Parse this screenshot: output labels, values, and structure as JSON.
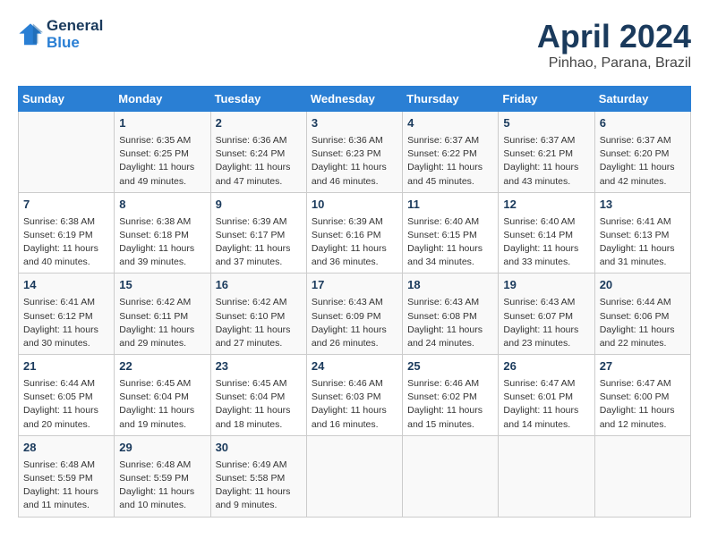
{
  "header": {
    "logo_line1": "General",
    "logo_line2": "Blue",
    "month": "April 2024",
    "location": "Pinhao, Parana, Brazil"
  },
  "days_of_week": [
    "Sunday",
    "Monday",
    "Tuesday",
    "Wednesday",
    "Thursday",
    "Friday",
    "Saturday"
  ],
  "weeks": [
    [
      {
        "day": "",
        "content": ""
      },
      {
        "day": "1",
        "content": "Sunrise: 6:35 AM\nSunset: 6:25 PM\nDaylight: 11 hours\nand 49 minutes."
      },
      {
        "day": "2",
        "content": "Sunrise: 6:36 AM\nSunset: 6:24 PM\nDaylight: 11 hours\nand 47 minutes."
      },
      {
        "day": "3",
        "content": "Sunrise: 6:36 AM\nSunset: 6:23 PM\nDaylight: 11 hours\nand 46 minutes."
      },
      {
        "day": "4",
        "content": "Sunrise: 6:37 AM\nSunset: 6:22 PM\nDaylight: 11 hours\nand 45 minutes."
      },
      {
        "day": "5",
        "content": "Sunrise: 6:37 AM\nSunset: 6:21 PM\nDaylight: 11 hours\nand 43 minutes."
      },
      {
        "day": "6",
        "content": "Sunrise: 6:37 AM\nSunset: 6:20 PM\nDaylight: 11 hours\nand 42 minutes."
      }
    ],
    [
      {
        "day": "7",
        "content": "Sunrise: 6:38 AM\nSunset: 6:19 PM\nDaylight: 11 hours\nand 40 minutes."
      },
      {
        "day": "8",
        "content": "Sunrise: 6:38 AM\nSunset: 6:18 PM\nDaylight: 11 hours\nand 39 minutes."
      },
      {
        "day": "9",
        "content": "Sunrise: 6:39 AM\nSunset: 6:17 PM\nDaylight: 11 hours\nand 37 minutes."
      },
      {
        "day": "10",
        "content": "Sunrise: 6:39 AM\nSunset: 6:16 PM\nDaylight: 11 hours\nand 36 minutes."
      },
      {
        "day": "11",
        "content": "Sunrise: 6:40 AM\nSunset: 6:15 PM\nDaylight: 11 hours\nand 34 minutes."
      },
      {
        "day": "12",
        "content": "Sunrise: 6:40 AM\nSunset: 6:14 PM\nDaylight: 11 hours\nand 33 minutes."
      },
      {
        "day": "13",
        "content": "Sunrise: 6:41 AM\nSunset: 6:13 PM\nDaylight: 11 hours\nand 31 minutes."
      }
    ],
    [
      {
        "day": "14",
        "content": "Sunrise: 6:41 AM\nSunset: 6:12 PM\nDaylight: 11 hours\nand 30 minutes."
      },
      {
        "day": "15",
        "content": "Sunrise: 6:42 AM\nSunset: 6:11 PM\nDaylight: 11 hours\nand 29 minutes."
      },
      {
        "day": "16",
        "content": "Sunrise: 6:42 AM\nSunset: 6:10 PM\nDaylight: 11 hours\nand 27 minutes."
      },
      {
        "day": "17",
        "content": "Sunrise: 6:43 AM\nSunset: 6:09 PM\nDaylight: 11 hours\nand 26 minutes."
      },
      {
        "day": "18",
        "content": "Sunrise: 6:43 AM\nSunset: 6:08 PM\nDaylight: 11 hours\nand 24 minutes."
      },
      {
        "day": "19",
        "content": "Sunrise: 6:43 AM\nSunset: 6:07 PM\nDaylight: 11 hours\nand 23 minutes."
      },
      {
        "day": "20",
        "content": "Sunrise: 6:44 AM\nSunset: 6:06 PM\nDaylight: 11 hours\nand 22 minutes."
      }
    ],
    [
      {
        "day": "21",
        "content": "Sunrise: 6:44 AM\nSunset: 6:05 PM\nDaylight: 11 hours\nand 20 minutes."
      },
      {
        "day": "22",
        "content": "Sunrise: 6:45 AM\nSunset: 6:04 PM\nDaylight: 11 hours\nand 19 minutes."
      },
      {
        "day": "23",
        "content": "Sunrise: 6:45 AM\nSunset: 6:04 PM\nDaylight: 11 hours\nand 18 minutes."
      },
      {
        "day": "24",
        "content": "Sunrise: 6:46 AM\nSunset: 6:03 PM\nDaylight: 11 hours\nand 16 minutes."
      },
      {
        "day": "25",
        "content": "Sunrise: 6:46 AM\nSunset: 6:02 PM\nDaylight: 11 hours\nand 15 minutes."
      },
      {
        "day": "26",
        "content": "Sunrise: 6:47 AM\nSunset: 6:01 PM\nDaylight: 11 hours\nand 14 minutes."
      },
      {
        "day": "27",
        "content": "Sunrise: 6:47 AM\nSunset: 6:00 PM\nDaylight: 11 hours\nand 12 minutes."
      }
    ],
    [
      {
        "day": "28",
        "content": "Sunrise: 6:48 AM\nSunset: 5:59 PM\nDaylight: 11 hours\nand 11 minutes."
      },
      {
        "day": "29",
        "content": "Sunrise: 6:48 AM\nSunset: 5:59 PM\nDaylight: 11 hours\nand 10 minutes."
      },
      {
        "day": "30",
        "content": "Sunrise: 6:49 AM\nSunset: 5:58 PM\nDaylight: 11 hours\nand 9 minutes."
      },
      {
        "day": "",
        "content": ""
      },
      {
        "day": "",
        "content": ""
      },
      {
        "day": "",
        "content": ""
      },
      {
        "day": "",
        "content": ""
      }
    ]
  ]
}
